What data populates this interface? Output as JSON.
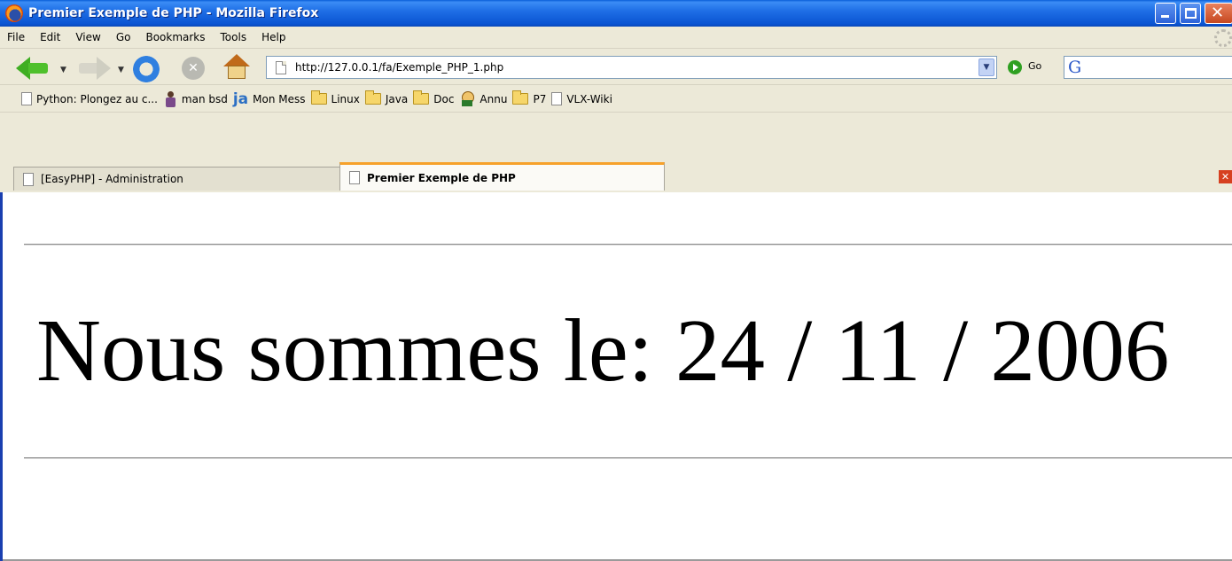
{
  "window": {
    "title": "Premier Exemple de PHP - Mozilla Firefox"
  },
  "menubar": {
    "items": [
      "File",
      "Edit",
      "View",
      "Go",
      "Bookmarks",
      "Tools",
      "Help"
    ]
  },
  "navbar": {
    "url": "http://127.0.0.1/fa/Exemple_PHP_1.php",
    "go_label": "Go"
  },
  "bookmarks": [
    {
      "label": "Python: Plongez au c...",
      "icon": "page-icon"
    },
    {
      "label": "man bsd",
      "icon": "person-icon"
    },
    {
      "label": "Mon Mess",
      "icon": "ja-icon"
    },
    {
      "label": "Linux",
      "icon": "folder-icon"
    },
    {
      "label": "Java",
      "icon": "folder-icon"
    },
    {
      "label": "Doc",
      "icon": "folder-icon"
    },
    {
      "label": "Annu",
      "icon": "person-icon"
    },
    {
      "label": "P7",
      "icon": "folder-icon"
    },
    {
      "label": "VLX-Wiki",
      "icon": "page-icon"
    }
  ],
  "tabs": [
    {
      "label": "[EasyPHP] - Administration",
      "active": false
    },
    {
      "label": "Premier Exemple de PHP",
      "active": true
    }
  ],
  "page": {
    "text": "Nous sommes le: 24 / 11 / 2006"
  },
  "colors": {
    "titlebar": "#0a54d2",
    "active_tab_accent": "#f6a12a"
  }
}
